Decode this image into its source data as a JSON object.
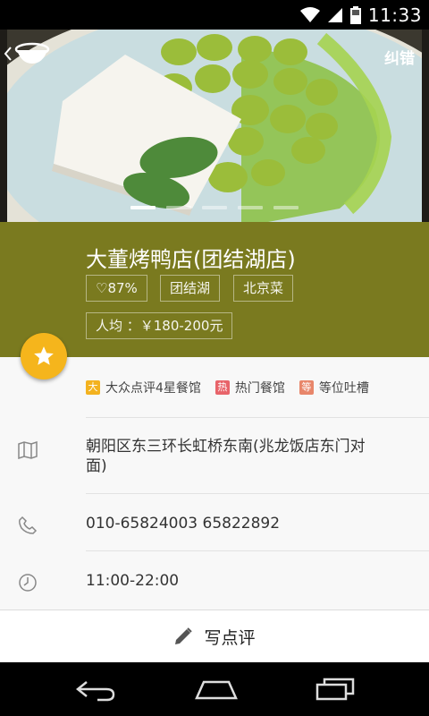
{
  "status_bar": {
    "time": "11:33"
  },
  "header": {
    "correct_label": "纠错"
  },
  "hero": {
    "page_count": 5,
    "active_page": 0
  },
  "shop": {
    "name": "大董烤鸭店(团结湖店)",
    "rating": "87%",
    "area": "团结湖",
    "cuisine": "北京菜",
    "avg_price": "人均 ：￥180-200元"
  },
  "badges": [
    {
      "icon": "大",
      "label": "大众点评4星餐馆",
      "color": "#f3b21f"
    },
    {
      "icon": "热",
      "label": "热门餐馆",
      "color": "#e8646a"
    },
    {
      "icon": "等",
      "label": "等位吐槽",
      "color": "#e8866a"
    }
  ],
  "details": {
    "address": "朝阳区东三环长虹桥东南(兆龙饭店东门对面)",
    "phone": "010-65824003  65822892",
    "hours": "11:00-22:00"
  },
  "actions": {
    "write_review": "写点评"
  }
}
